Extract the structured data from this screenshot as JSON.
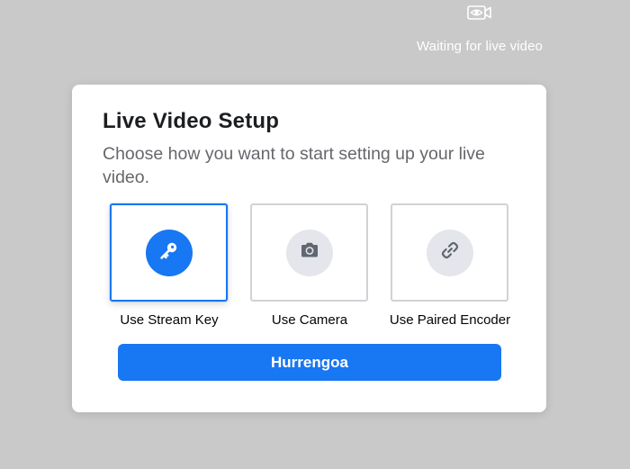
{
  "status": {
    "icon": "video-eye-icon",
    "text": "Waiting for live video"
  },
  "dialog": {
    "title": "Live Video Setup",
    "description": "Choose how you want to start setting up your live video.",
    "options": [
      {
        "label": "Use Stream Key",
        "icon": "key-icon",
        "selected": true
      },
      {
        "label": "Use Camera",
        "icon": "camera-icon",
        "selected": false
      },
      {
        "label": "Use Paired Encoder",
        "icon": "link-icon",
        "selected": false
      }
    ],
    "next_label": "Hurrengoa"
  },
  "colors": {
    "accent": "#1877f2",
    "background": "#c9c9c9",
    "icon_circle": "#e4e6eb",
    "icon_gray": "#606770"
  }
}
